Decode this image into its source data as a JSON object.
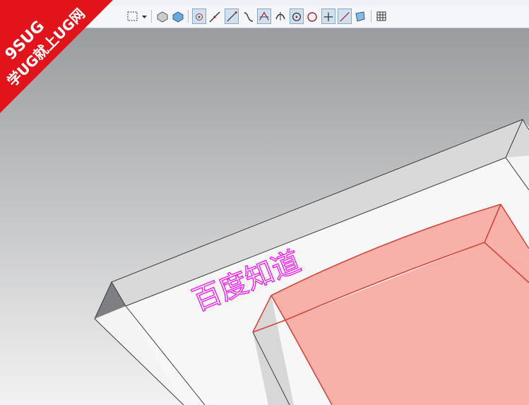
{
  "app": {
    "watermark_text": "百度知道",
    "badge": {
      "line1": "9SUG",
      "line2": "学UG就上UG网",
      "color": "#e1141c"
    }
  },
  "toolbar": {
    "buttons": [
      {
        "name": "select-filter-icon",
        "active": false
      },
      {
        "name": "dropdown-arrow-icon",
        "active": false
      },
      {
        "name": "render-wireframe-icon",
        "active": false
      },
      {
        "name": "render-shaded-icon",
        "active": false
      },
      {
        "name": "snap-endpoint-icon",
        "active": true
      },
      {
        "name": "snap-midpoint-icon",
        "active": false
      },
      {
        "name": "snap-control-point-icon",
        "active": true
      },
      {
        "name": "snap-curve-icon",
        "active": false
      },
      {
        "name": "snap-intersection-icon",
        "active": true
      },
      {
        "name": "snap-perpendicular-icon",
        "active": false
      },
      {
        "name": "snap-arc-center-icon",
        "active": true
      },
      {
        "name": "snap-quadrant-icon",
        "active": false
      },
      {
        "name": "snap-point-icon",
        "active": true
      },
      {
        "name": "snap-on-curve-icon",
        "active": true
      },
      {
        "name": "snap-on-face-icon",
        "active": false
      },
      {
        "name": "grid-icon",
        "active": false
      }
    ]
  },
  "colors": {
    "background_top": "#9a9c9f",
    "background_bottom": "#f2f2f2",
    "body_fill": "#f4f4f4",
    "body_edge": "#3a3a3a",
    "cut_fill": "#f6a9a0",
    "cut_edge": "#d6453a",
    "watermark": "#ee22ee"
  }
}
